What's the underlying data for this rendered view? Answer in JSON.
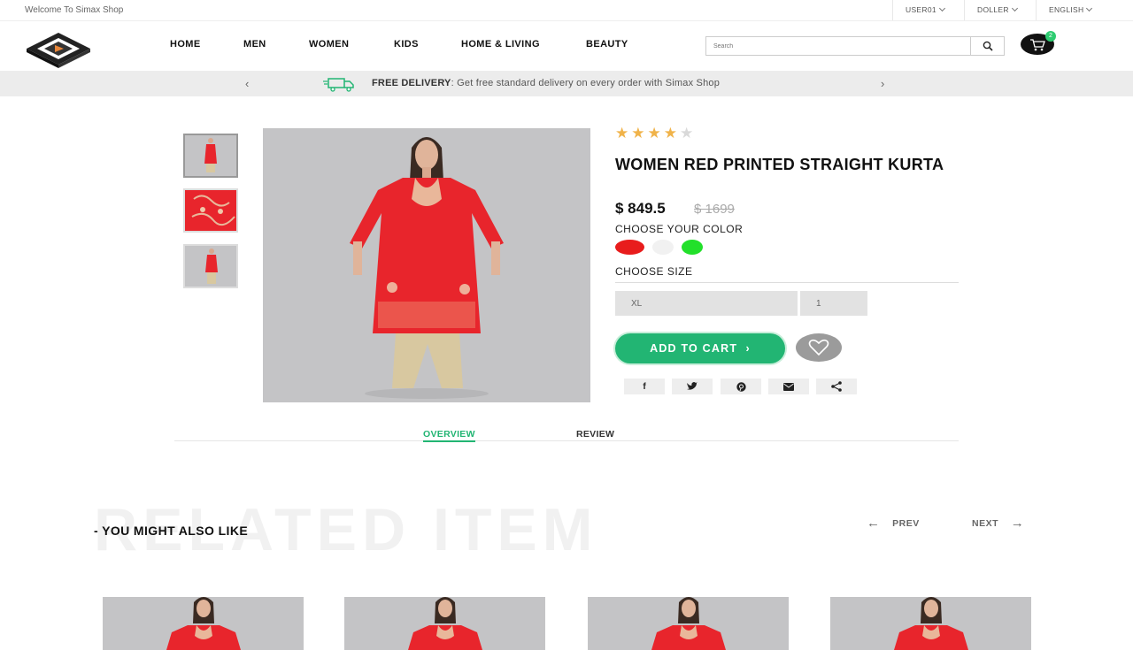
{
  "topbar": {
    "welcome": "Welcome To Simax Shop",
    "user": "USER01",
    "currency": "DOLLER",
    "language": "ENGLISH"
  },
  "nav": [
    "HOME",
    "MEN",
    "WOMEN",
    "KIDS",
    "HOME & LIVING",
    "BEAUTY"
  ],
  "search": {
    "placeholder": "Search"
  },
  "cart": {
    "count": "2"
  },
  "promo": {
    "label": "FREE DELIVERY",
    "text": ": Get free standard delivery on every order with Simax Shop"
  },
  "product": {
    "rating": 4,
    "rating_max": 5,
    "title": "WOMEN RED PRINTED STRAIGHT KURTA",
    "price": "$ 849.5",
    "old_price": "$ 1699",
    "choose_color": "CHOOSE YOUR COLOR",
    "colors": [
      "#e81c1c",
      "#f1f1f1",
      "#22e02a"
    ],
    "choose_size": "CHOOSE SIZE",
    "size": "XL",
    "quantity": "1",
    "add_to_cart": "ADD TO CART",
    "share_icons": [
      "facebook-icon",
      "twitter-icon",
      "pinterest-icon",
      "mail-icon",
      "share-icon"
    ]
  },
  "tabs": [
    "OVERVIEW",
    "REVIEW"
  ],
  "related": {
    "watermark": "RELATED ITEM",
    "heading": "- YOU MIGHT ALSO LIKE",
    "prev": "PREV",
    "next": "NEXT"
  },
  "colors": {
    "accent": "#22b573",
    "star": "#f0b34a",
    "star_empty": "#d9d9d9",
    "kurta": "#e8252c"
  }
}
